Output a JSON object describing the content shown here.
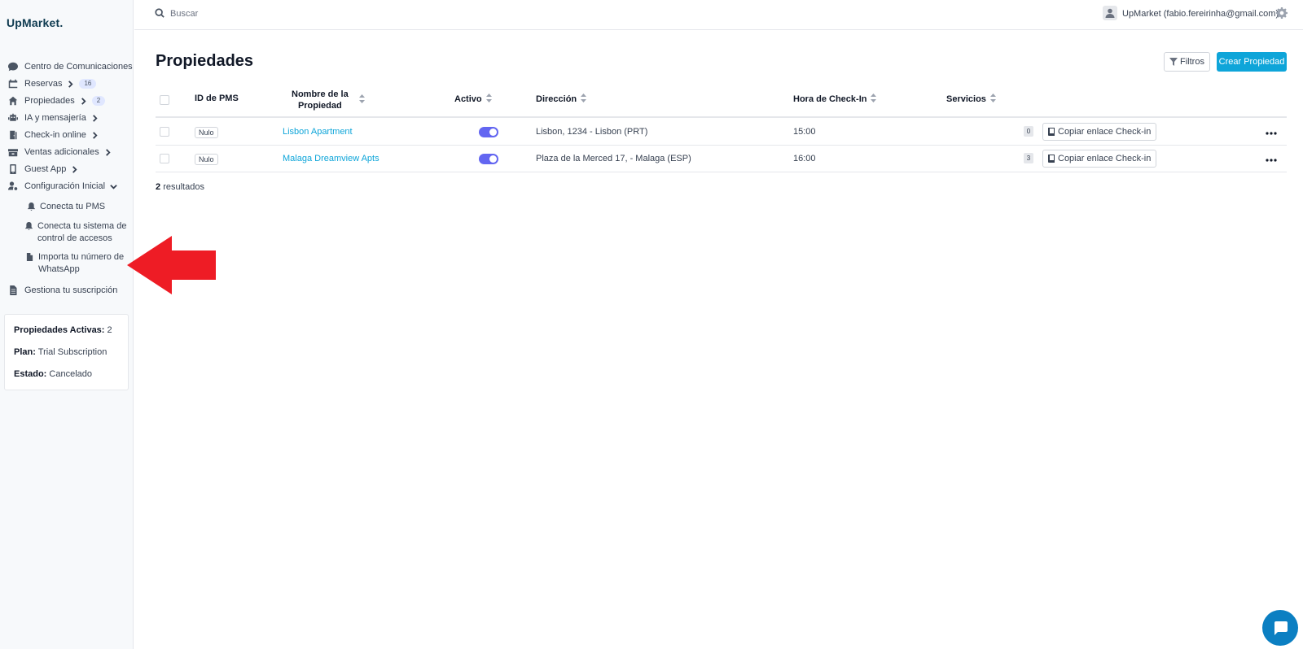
{
  "app": {
    "logo": "UpMarket."
  },
  "topbar": {
    "search_placeholder": "Buscar",
    "user": "UpMarket (fabio.fereirinha@gmail.com)"
  },
  "sidebar": {
    "items": [
      {
        "label": "Centro de Comunicaciones",
        "icon": "chat-icon"
      },
      {
        "label": "Reservas",
        "icon": "calendar-icon",
        "count": "16"
      },
      {
        "label": "Propiedades",
        "icon": "home-icon",
        "count": "2"
      },
      {
        "label": "IA y mensajería",
        "icon": "robot-icon"
      },
      {
        "label": "Check-in online",
        "icon": "door-icon"
      },
      {
        "label": "Ventas adicionales",
        "icon": "box-icon"
      },
      {
        "label": "Guest App",
        "icon": "mobile-icon"
      },
      {
        "label": "Configuración Inicial",
        "icon": "user-gear-icon"
      }
    ],
    "sub_items": [
      {
        "label_lines": [
          "Conecta tu PMS"
        ],
        "icon": "bell-icon"
      },
      {
        "label_lines": [
          "Conecta tu sistema de",
          "control de accesos"
        ],
        "icon": "bell-icon"
      },
      {
        "label_lines": [
          "Importa tu número de",
          "WhatsApp"
        ],
        "icon": "file-icon"
      }
    ],
    "manage": {
      "label": "Gestiona tu suscripción",
      "icon": "document-icon"
    },
    "stats": {
      "active_label": "Propiedades Activas:",
      "active_value": "2",
      "plan_label": "Plan:",
      "plan_value": "Trial Subscription",
      "status_label": "Estado:",
      "status_value": "Cancelado"
    }
  },
  "main": {
    "title": "Propiedades",
    "filter_label": "Filtros",
    "create_label": "Crear Propiedad",
    "columns": {
      "pms_id": "ID de PMS",
      "name_line1": "Nombre de la",
      "name_line2": "Propiedad",
      "active": "Activo",
      "address": "Dirección",
      "checkin_time": "Hora de Check-In",
      "services": "Servicios"
    },
    "rows": [
      {
        "pms_id": "Nulo",
        "name": "Lisbon Apartment",
        "active": true,
        "address": "Lisbon, 1234 - Lisbon (PRT)",
        "checkin_time": "15:00",
        "services": "0",
        "copy_label": "Copiar enlace Check-in"
      },
      {
        "pms_id": "Nulo",
        "name": "Malaga Dreamview Apts",
        "active": true,
        "address": "Plaza de la Merced 17, - Malaga (ESP)",
        "checkin_time": "16:00",
        "services": "3",
        "copy_label": "Copiar enlace Check-in"
      }
    ],
    "results_count": "2",
    "results_label": "resultados"
  },
  "colors": {
    "accent": "#0ea5d9",
    "toggle": "#6366f1",
    "annotation_arrow": "#ee1c25",
    "chat": "#0b7fc2"
  }
}
